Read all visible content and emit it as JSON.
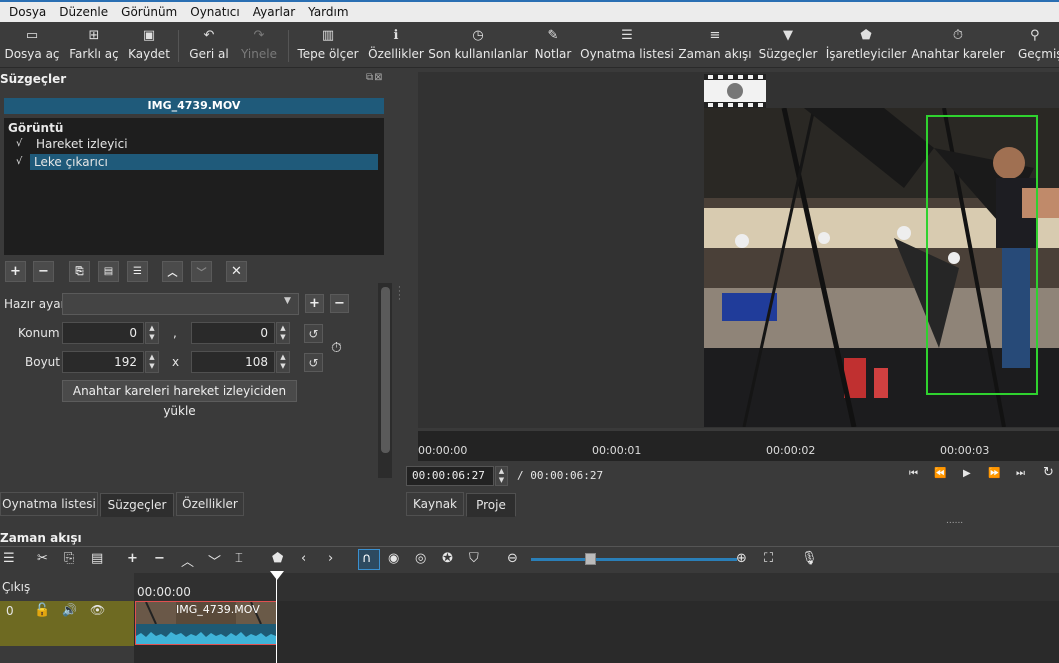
{
  "menu": [
    "Dosya",
    "Düzenle",
    "Görünüm",
    "Oynatıcı",
    "Ayarlar",
    "Yardım"
  ],
  "toolbar": {
    "open": "Dosya aç",
    "open_other": "Farklı aç",
    "save": "Kaydet",
    "undo": "Geri al",
    "redo": "Yinele",
    "peak_meter": "Tepe ölçer",
    "properties": "Özellikler",
    "recent": "Son kullanılanlar",
    "notes": "Notlar",
    "playlist": "Oynatma listesi",
    "timeline": "Zaman akışı",
    "filters": "Süzgeçler",
    "markers": "İşaretleyiciler",
    "keyframes": "Anahtar kareler",
    "history": "Geçmiş"
  },
  "filters_panel": {
    "title": "Süzgeçler",
    "clip_name": "IMG_4739.MOV",
    "category": "Görüntü",
    "items": [
      {
        "label": "Hareket izleyici",
        "checked": "√"
      },
      {
        "label": "Leke çıkarıcı",
        "checked": "√"
      }
    ],
    "preset_label": "Hazır ayar",
    "position_label": "Konum",
    "position_x": "0",
    "position_sep": ",",
    "position_y": "0",
    "size_label": "Boyut",
    "size_w": "192",
    "size_sep": "x",
    "size_h": "108",
    "load_keyframes": "Anahtar kareleri hareket izleyiciden yükle"
  },
  "left_tabs": [
    "Oynatma listesi",
    "Süzgeçler",
    "Özellikler"
  ],
  "player": {
    "ruler_ticks": [
      "00:00:00",
      "00:00:01",
      "00:00:02",
      "00:00:03"
    ],
    "current_time": "00:00:06:27",
    "total_time": "/ 00:00:06:27",
    "tabs": [
      "Kaynak",
      "Proje"
    ],
    "dots": "......"
  },
  "timeline": {
    "title": "Zaman akışı",
    "output_label": "Çıkış",
    "track_number": "0",
    "ruler_start": "00:00:00",
    "clip_label": "IMG_4739.MOV"
  },
  "colors": {
    "accent": "#1f5a7a",
    "track_box": "#2fd22f",
    "track_header": "#6e6a22",
    "clip_border": "#e05050"
  }
}
